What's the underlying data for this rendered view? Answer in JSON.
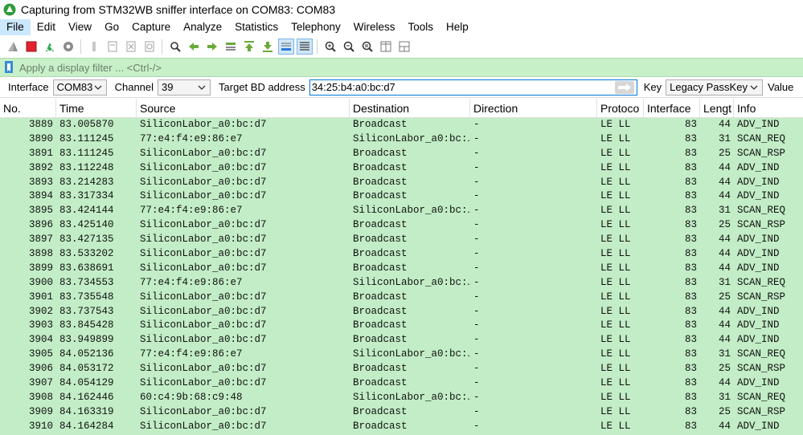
{
  "window": {
    "title": "Capturing from STM32WB sniffer interface on COM83: COM83"
  },
  "menu": [
    "File",
    "Edit",
    "View",
    "Go",
    "Capture",
    "Analyze",
    "Statistics",
    "Telephony",
    "Wireless",
    "Tools",
    "Help"
  ],
  "toolbar": {
    "buttons": [
      "shark-fin-start-icon",
      "stop-square-icon",
      "restart-capture-icon",
      "capture-options-gear-icon",
      "open-file-icon",
      "save-file-icon",
      "close-file-icon",
      "reload-file-icon",
      "find-packet-icon",
      "go-back-icon",
      "go-forward-icon",
      "go-to-packet-icon",
      "go-first-icon",
      "go-last-icon",
      "auto-scroll-icon",
      "colorize-icon",
      "zoom-in-icon",
      "zoom-out-icon",
      "zoom-normal-icon",
      "resize-columns-icon",
      "layout-panes-icon"
    ]
  },
  "filter": {
    "placeholder": "Apply a display filter ... <Ctrl-/>"
  },
  "interface_bar": {
    "interface_label": "Interface",
    "interface_value": "COM83",
    "channel_label": "Channel",
    "channel_value": "39",
    "target_label": "Target BD address",
    "target_value": "34:25:b4:a0:bc:d7",
    "key_label": "Key",
    "key_value": "Legacy PassKey",
    "value_label": "Value"
  },
  "columns": [
    "No.",
    "Time",
    "Source",
    "Destination",
    "Direction",
    "Protoco",
    "Interface",
    "Lengt",
    "Info"
  ],
  "packets": [
    [
      "3889",
      "83.005870",
      "SiliconLabor_a0:bc:d7",
      "Broadcast",
      "-",
      "LE LL",
      "83",
      "44",
      "ADV_IND"
    ],
    [
      "3890",
      "83.111245",
      "77:e4:f4:e9:86:e7",
      "SiliconLabor_a0:bc:…",
      "-",
      "LE LL",
      "83",
      "31",
      "SCAN_REQ"
    ],
    [
      "3891",
      "83.111245",
      "SiliconLabor_a0:bc:d7",
      "Broadcast",
      "-",
      "LE LL",
      "83",
      "25",
      "SCAN_RSP"
    ],
    [
      "3892",
      "83.112248",
      "SiliconLabor_a0:bc:d7",
      "Broadcast",
      "-",
      "LE LL",
      "83",
      "44",
      "ADV_IND"
    ],
    [
      "3893",
      "83.214283",
      "SiliconLabor_a0:bc:d7",
      "Broadcast",
      "-",
      "LE LL",
      "83",
      "44",
      "ADV_IND"
    ],
    [
      "3894",
      "83.317334",
      "SiliconLabor_a0:bc:d7",
      "Broadcast",
      "-",
      "LE LL",
      "83",
      "44",
      "ADV_IND"
    ],
    [
      "3895",
      "83.424144",
      "77:e4:f4:e9:86:e7",
      "SiliconLabor_a0:bc:…",
      "-",
      "LE LL",
      "83",
      "31",
      "SCAN_REQ"
    ],
    [
      "3896",
      "83.425140",
      "SiliconLabor_a0:bc:d7",
      "Broadcast",
      "-",
      "LE LL",
      "83",
      "25",
      "SCAN_RSP"
    ],
    [
      "3897",
      "83.427135",
      "SiliconLabor_a0:bc:d7",
      "Broadcast",
      "-",
      "LE LL",
      "83",
      "44",
      "ADV_IND"
    ],
    [
      "3898",
      "83.533202",
      "SiliconLabor_a0:bc:d7",
      "Broadcast",
      "-",
      "LE LL",
      "83",
      "44",
      "ADV_IND"
    ],
    [
      "3899",
      "83.638691",
      "SiliconLabor_a0:bc:d7",
      "Broadcast",
      "-",
      "LE LL",
      "83",
      "44",
      "ADV_IND"
    ],
    [
      "3900",
      "83.734553",
      "77:e4:f4:e9:86:e7",
      "SiliconLabor_a0:bc:…",
      "-",
      "LE LL",
      "83",
      "31",
      "SCAN_REQ"
    ],
    [
      "3901",
      "83.735548",
      "SiliconLabor_a0:bc:d7",
      "Broadcast",
      "-",
      "LE LL",
      "83",
      "25",
      "SCAN_RSP"
    ],
    [
      "3902",
      "83.737543",
      "SiliconLabor_a0:bc:d7",
      "Broadcast",
      "-",
      "LE LL",
      "83",
      "44",
      "ADV_IND"
    ],
    [
      "3903",
      "83.845428",
      "SiliconLabor_a0:bc:d7",
      "Broadcast",
      "-",
      "LE LL",
      "83",
      "44",
      "ADV_IND"
    ],
    [
      "3904",
      "83.949899",
      "SiliconLabor_a0:bc:d7",
      "Broadcast",
      "-",
      "LE LL",
      "83",
      "44",
      "ADV_IND"
    ],
    [
      "3905",
      "84.052136",
      "77:e4:f4:e9:86:e7",
      "SiliconLabor_a0:bc:…",
      "-",
      "LE LL",
      "83",
      "31",
      "SCAN_REQ"
    ],
    [
      "3906",
      "84.053172",
      "SiliconLabor_a0:bc:d7",
      "Broadcast",
      "-",
      "LE LL",
      "83",
      "25",
      "SCAN_RSP"
    ],
    [
      "3907",
      "84.054129",
      "SiliconLabor_a0:bc:d7",
      "Broadcast",
      "-",
      "LE LL",
      "83",
      "44",
      "ADV_IND"
    ],
    [
      "3908",
      "84.162446",
      "60:c4:9b:68:c9:48",
      "SiliconLabor_a0:bc:…",
      "-",
      "LE LL",
      "83",
      "31",
      "SCAN_REQ"
    ],
    [
      "3909",
      "84.163319",
      "SiliconLabor_a0:bc:d7",
      "Broadcast",
      "-",
      "LE LL",
      "83",
      "25",
      "SCAN_RSP"
    ],
    [
      "3910",
      "84.164284",
      "SiliconLabor_a0:bc:d7",
      "Broadcast",
      "-",
      "LE LL",
      "83",
      "44",
      "ADV_IND"
    ]
  ],
  "colors": {
    "row_bg": "#c2edc6",
    "filter_bg": "#c8f0c8",
    "menu_active": "#cce8ff",
    "input_focus": "#0078d7"
  }
}
